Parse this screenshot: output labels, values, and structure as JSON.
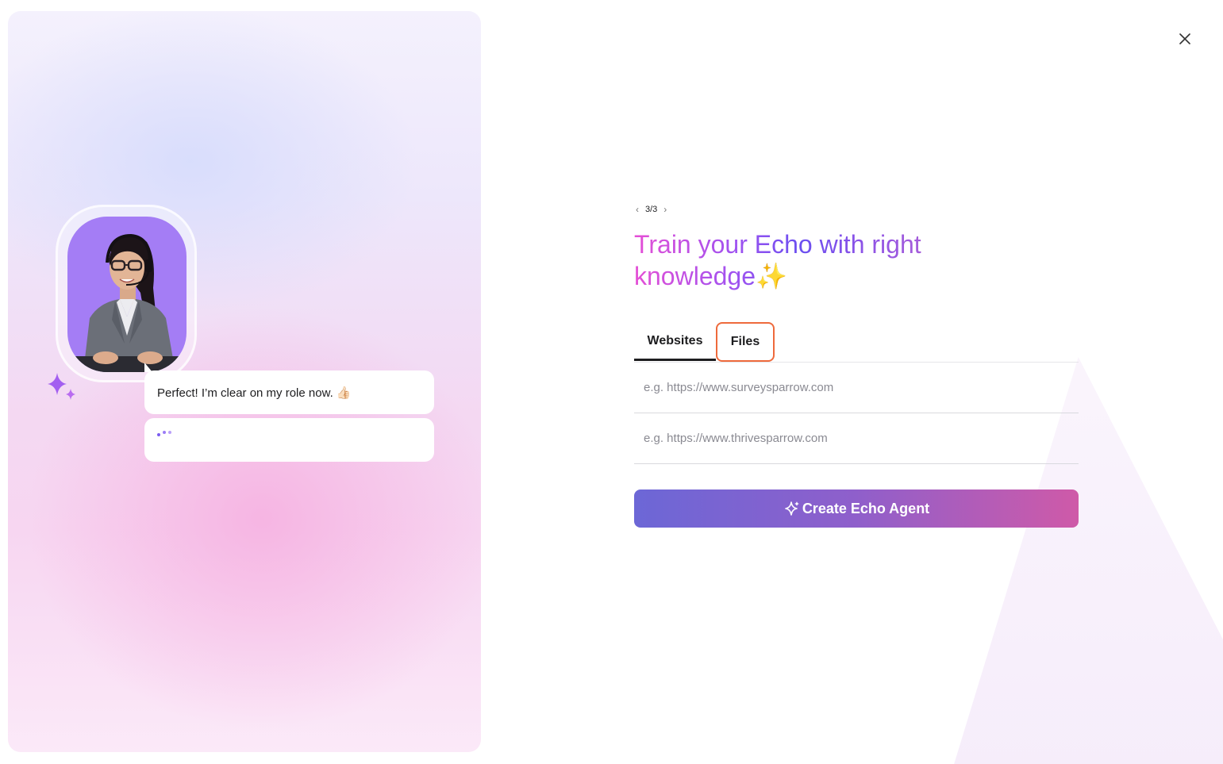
{
  "pager": {
    "current": "3/3"
  },
  "title": {
    "text": "Train your Echo with right knowledge",
    "emoji": "✨"
  },
  "tabs": [
    {
      "label": "Websites",
      "active": true
    },
    {
      "label": "Files",
      "active": false,
      "highlighted": true
    }
  ],
  "fields": [
    {
      "placeholder": "e.g. https://www.surveysparrow.com",
      "value": ""
    },
    {
      "placeholder": "e.g. https://www.thrivesparrow.com",
      "value": ""
    }
  ],
  "create_button": {
    "label": "Create Echo Agent",
    "icon": "sparkle-icon"
  },
  "chat": {
    "messages": [
      {
        "text": "Perfect! I’m clear on my role now. 👍🏻"
      },
      {
        "typing": true
      }
    ]
  },
  "colors": {
    "accent_purple": "#7b5cf0",
    "button_gradient_start": "#6c67d6",
    "button_gradient_end": "#cf5aa8",
    "files_tab_outline": "#ee6a3c",
    "avatar_bg": "#a47df5"
  },
  "icons": [
    "close-icon",
    "chevron-left-icon",
    "chevron-right-icon",
    "sparkle-icon",
    "agent-avatar"
  ]
}
